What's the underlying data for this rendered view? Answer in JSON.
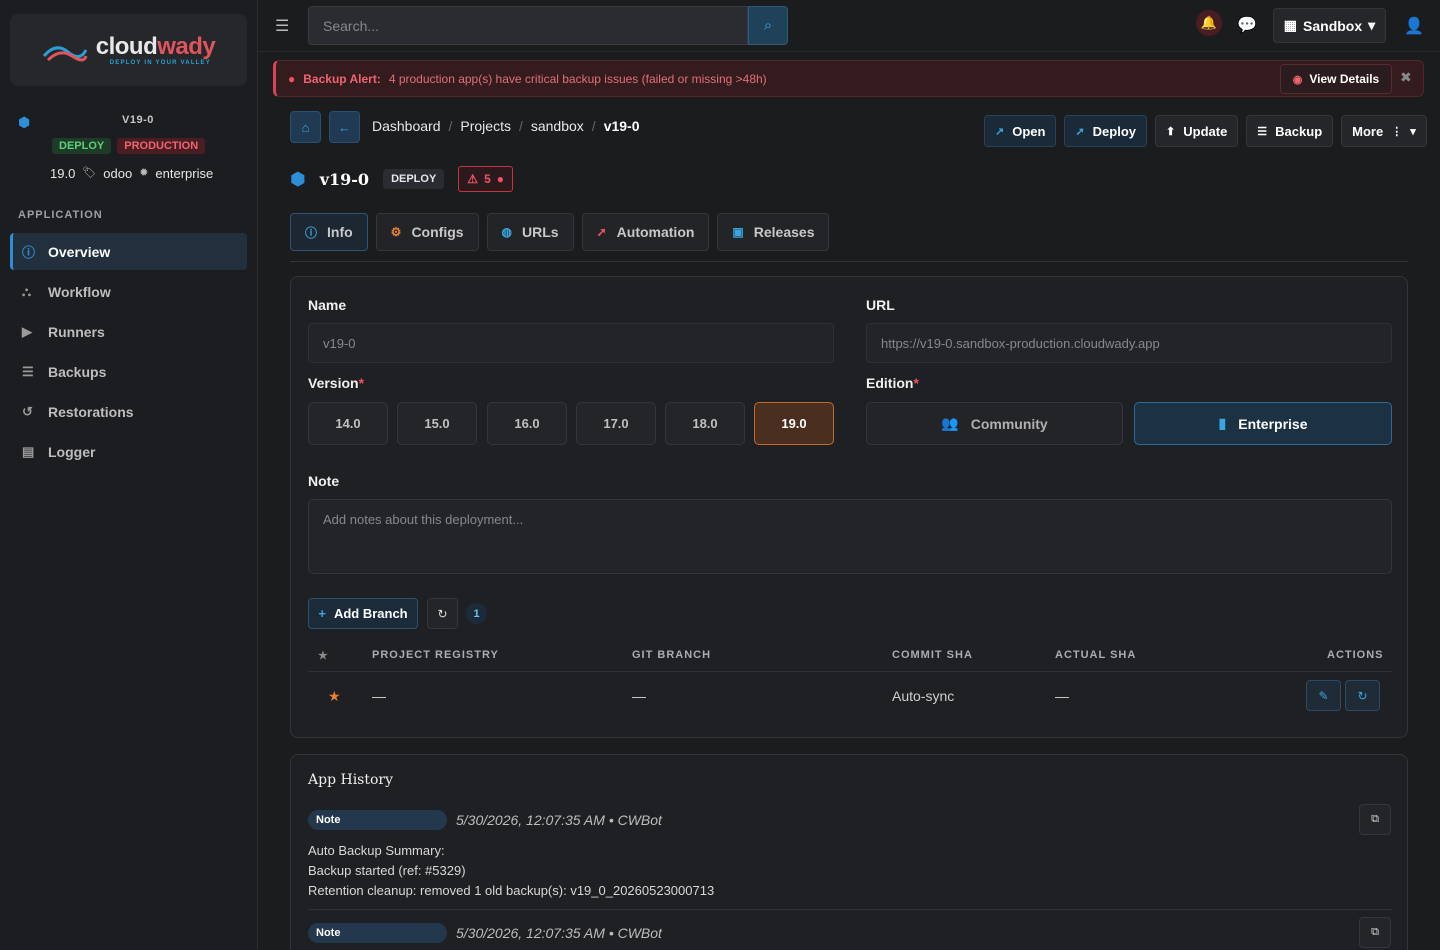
{
  "brand": {
    "word_main": "cloud",
    "word_accent": "wady",
    "tagline": "DEPLOY IN YOUR VALLEY"
  },
  "sidebar": {
    "app_name": "V19-0",
    "badges": {
      "deploy": "DEPLOY",
      "env": "PRODUCTION"
    },
    "meta": {
      "version": "19.0",
      "product": "odoo",
      "edition": "enterprise"
    },
    "section_label": "APPLICATION",
    "items": [
      {
        "label": "Overview",
        "icon": "info-icon",
        "active": true
      },
      {
        "label": "Workflow",
        "icon": "sitemap-icon"
      },
      {
        "label": "Runners",
        "icon": "play-circle-icon"
      },
      {
        "label": "Backups",
        "icon": "database-icon"
      },
      {
        "label": "Restorations",
        "icon": "history-icon"
      },
      {
        "label": "Logger",
        "icon": "file-icon"
      }
    ]
  },
  "topbar": {
    "search_placeholder": "Search...",
    "environment": "Sandbox"
  },
  "alert": {
    "title": "Backup Alert:",
    "message": "4 production app(s) have critical backup issues (failed or missing >48h)",
    "button": "View Details"
  },
  "breadcrumb": [
    "Dashboard",
    "Projects",
    "sandbox",
    "v19-0"
  ],
  "actions": {
    "open": "Open",
    "deploy": "Deploy",
    "update": "Update",
    "backup": "Backup",
    "more": "More"
  },
  "app": {
    "title": "v19-0",
    "badge": "DEPLOY",
    "warnings": "5"
  },
  "tabs": [
    "Info",
    "Configs",
    "URLs",
    "Automation",
    "Releases"
  ],
  "form": {
    "name_label": "Name",
    "name_value": "v19-0",
    "url_label": "URL",
    "url_value": "https://v19-0.sandbox-production.cloudwady.app",
    "version_label": "Version",
    "versions": [
      "14.0",
      "15.0",
      "16.0",
      "17.0",
      "18.0",
      "19.0"
    ],
    "selected_version": "19.0",
    "edition_label": "Edition",
    "editions": {
      "community": "Community",
      "enterprise": "Enterprise"
    },
    "selected_edition": "Enterprise",
    "note_label": "Note",
    "note_placeholder": "Add notes about this deployment..."
  },
  "branches": {
    "add_label": "Add Branch",
    "count": "1",
    "headers": {
      "star": "★",
      "registry": "PROJECT REGISTRY",
      "branch": "GIT BRANCH",
      "commit": "COMMIT SHA",
      "actual": "ACTUAL SHA",
      "actions": "ACTIONS"
    },
    "rows": [
      {
        "registry": "—",
        "branch": "—",
        "commit": "Auto-sync",
        "actual": "—"
      }
    ]
  },
  "history": {
    "title": "App History",
    "entries": [
      {
        "type": "Note",
        "meta": "5/30/2026, 12:07:35 AM • CWBot",
        "lines": [
          "Auto Backup Summary:",
          "Backup started (ref: #5329)",
          "Retention cleanup: removed 1 old backup(s): v19_0_20260523000713"
        ]
      },
      {
        "type": "Note",
        "meta": "5/30/2026, 12:07:35 AM • CWBot",
        "lines": []
      }
    ]
  },
  "colors": {
    "accent": "#2e8fd8",
    "danger": "#ef5360",
    "success": "#5ed07c",
    "selected_version": "#c06a2e"
  }
}
